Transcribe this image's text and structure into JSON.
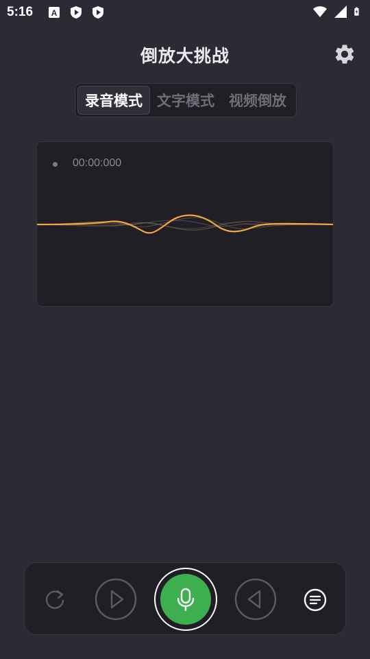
{
  "status_bar": {
    "time": "5:16",
    "left_icons": [
      "a-icon",
      "shield-play-icon",
      "shield-play-icon"
    ],
    "right_icons": [
      "wifi-icon",
      "signal-icon",
      "battery-charging-icon"
    ]
  },
  "header": {
    "title": "倒放大挑战",
    "settings_icon": "gear-icon"
  },
  "tabs": [
    {
      "label": "录音模式",
      "active": true
    },
    {
      "label": "文字模式",
      "active": false
    },
    {
      "label": "视频倒放",
      "active": false
    }
  ],
  "recorder": {
    "timer": "00:00:000"
  },
  "controls": {
    "replay_icon": "replay-icon",
    "play_icon": "play-icon",
    "mic_icon": "microphone-icon",
    "reverse_icon": "reverse-play-icon",
    "list_icon": "list-icon"
  },
  "colors": {
    "background": "#2b2b35",
    "panel": "#1f1f25",
    "accent_wave": "#f2a541",
    "mic_green": "#3daf4f"
  }
}
